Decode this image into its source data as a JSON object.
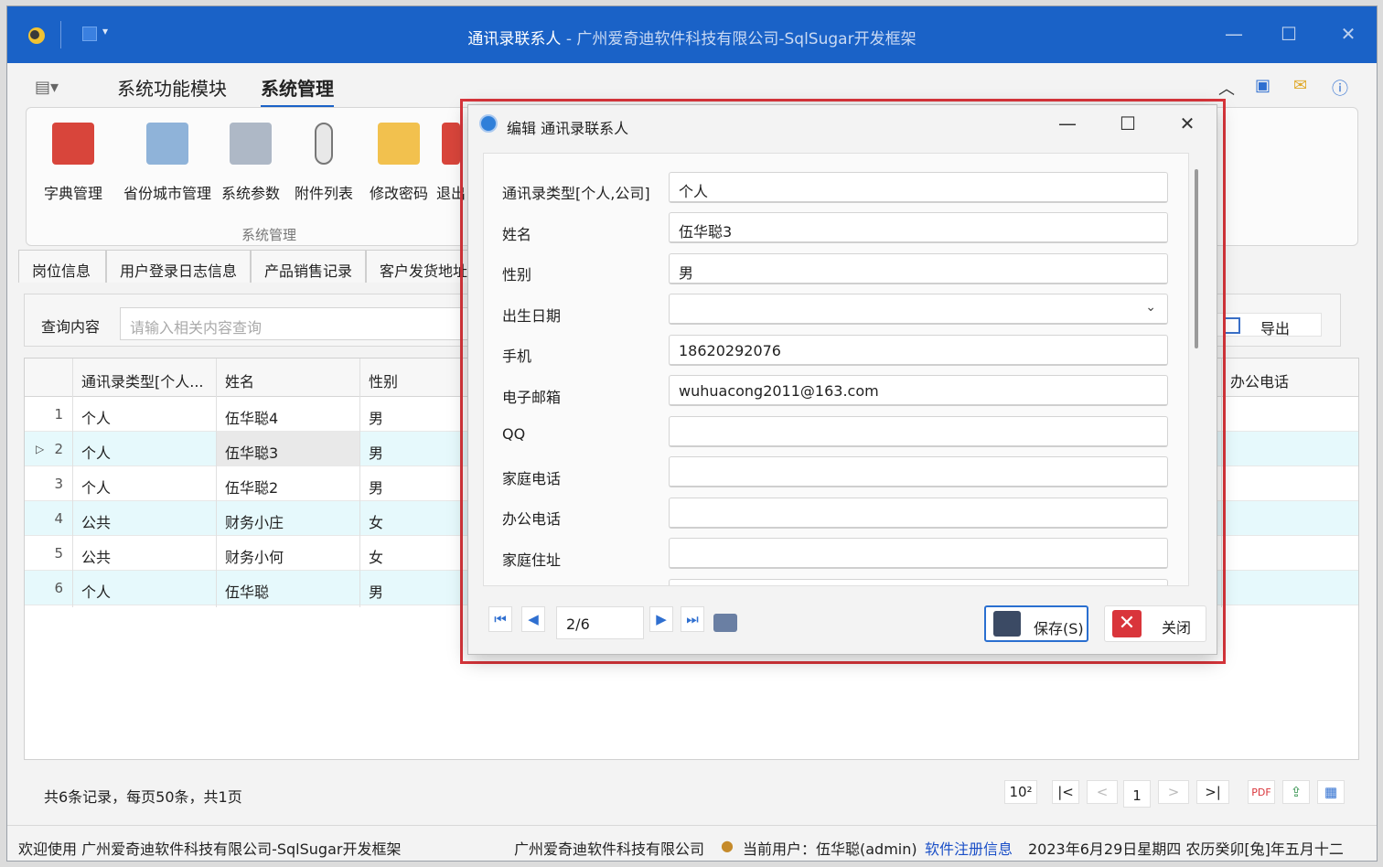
{
  "window": {
    "title": "通讯录联系人",
    "subtitle": " - 广州爱奇迪软件科技有限公司-SqlSugar开发框架"
  },
  "menubar": {
    "tabs": [
      "系统功能模块",
      "系统管理"
    ]
  },
  "ribbon": {
    "buttons": [
      "字典管理",
      "省份城市管理",
      "系统参数",
      "附件列表",
      "修改密码",
      "退出"
    ],
    "group_label": "系统管理"
  },
  "doc_tabs": [
    "岗位信息",
    "用户登录日志信息",
    "产品销售记录",
    "客户发货地址信"
  ],
  "search": {
    "label": "查询内容",
    "placeholder": "请输入相关内容查询",
    "export_label": "导出"
  },
  "grid": {
    "columns": [
      "通讯录类型[个人...",
      "姓名",
      "性别",
      "办公电话"
    ],
    "rows": [
      {
        "num": "1",
        "type": "个人",
        "name": "伍华聪4",
        "gender": "男"
      },
      {
        "num": "2",
        "type": "个人",
        "name": "伍华聪3",
        "gender": "男"
      },
      {
        "num": "3",
        "type": "个人",
        "name": "伍华聪2",
        "gender": "男"
      },
      {
        "num": "4",
        "type": "公共",
        "name": "财务小庄",
        "gender": "女"
      },
      {
        "num": "5",
        "type": "公共",
        "name": "财务小何",
        "gender": "女"
      },
      {
        "num": "6",
        "type": "个人",
        "name": "伍华聪",
        "gender": "男"
      }
    ]
  },
  "status": {
    "summary": "共6条记录，每页50条，共1页",
    "page": "1"
  },
  "footer": {
    "welcome": "欢迎使用 广州爱奇迪软件科技有限公司-SqlSugar开发框架",
    "company": "广州爱奇迪软件科技有限公司",
    "user": "当前用户：伍华聪(admin)",
    "register": "软件注册信息",
    "date": "2023年6月29日星期四 农历癸卯[兔]年五月十二"
  },
  "dialog": {
    "title": "编辑 通讯录联系人",
    "fields": [
      {
        "label": "通讯录类型[个人,公司]",
        "value": "个人"
      },
      {
        "label": "姓名",
        "value": "伍华聪3"
      },
      {
        "label": "性别",
        "value": "男"
      },
      {
        "label": "出生日期",
        "value": ""
      },
      {
        "label": "手机",
        "value": "18620292076"
      },
      {
        "label": "电子邮箱",
        "value": "wuhuacong2011@163.com"
      },
      {
        "label": "QQ",
        "value": ""
      },
      {
        "label": "家庭电话",
        "value": ""
      },
      {
        "label": "办公电话",
        "value": ""
      },
      {
        "label": "家庭住址",
        "value": ""
      }
    ],
    "position": "2/6",
    "save_label": "保存(S)",
    "close_label": "关闭"
  }
}
